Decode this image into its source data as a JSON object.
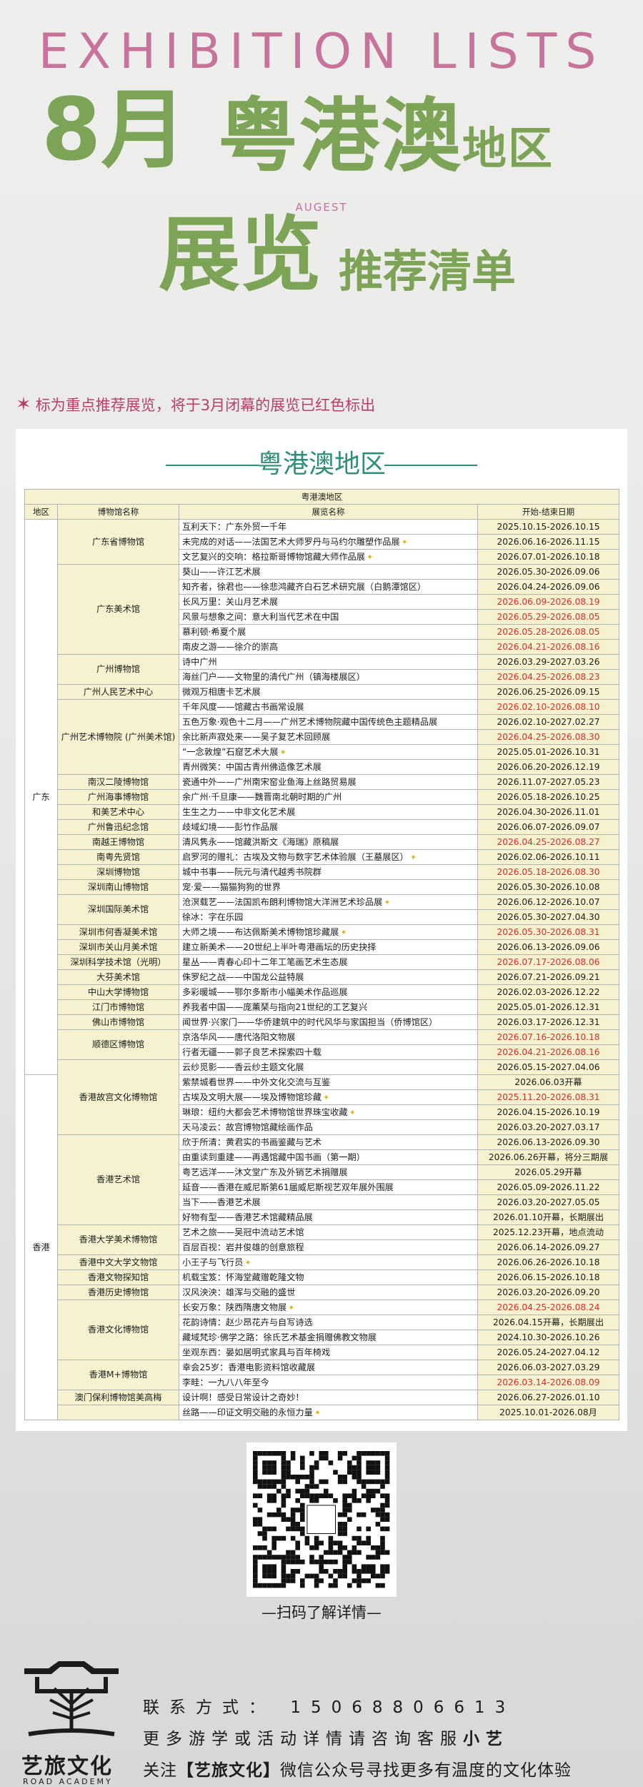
{
  "header": {
    "title_en": "EXHIBITION LISTS",
    "month": "8月",
    "region": "粤港澳",
    "region_suffix": "地区",
    "month_en": "AUGEST",
    "exhibit": "展览",
    "recommend": "推荐清单"
  },
  "note": "标为重点推荐展览，将于3月闭幕的展览已红色标出",
  "card_title": "粤港澳地区",
  "table": {
    "top_header": "粤港澳地区",
    "col_region": "地区",
    "col_venue": "博物馆名称",
    "col_exhibit": "展览名称",
    "col_date": "开始-结束日期",
    "regions": [
      "广东",
      "香港",
      ""
    ],
    "venues": [
      "广东省博物馆",
      "广东美术馆",
      "广州博物馆",
      "广州人民艺术中心",
      "广州艺术博物院 (广州美术馆)",
      "南汉二陵博物馆",
      "广州海事博物馆",
      "和美艺术中心",
      "广州鲁迅纪念馆",
      "南越王博物馆",
      "南粤先贤馆",
      "深圳博物馆",
      "深圳南山博物馆",
      "深圳国际美术馆",
      "深圳市何香凝美术馆",
      "深圳市关山月美术馆",
      "深圳科学技术馆（光明）",
      "大芬美术馆",
      "中山大学博物馆",
      "江门市博物馆",
      "佛山市博物馆",
      "顺德区博物馆",
      "香港故宫文化博物馆",
      "香港艺术馆",
      "香港大学美术博物馆",
      "香港中文大学文物馆",
      "香港文物探知馆",
      "香港历史博物馆",
      "香港文化博物馆",
      "香港M+博物馆",
      "澳门保利博物馆美高梅"
    ],
    "rows": [
      {
        "name": "互利天下：广东外贸一千年",
        "date": "2025.10.15-2026.10.15",
        "red": false,
        "star": false
      },
      {
        "name": "未完成的对话——法国艺术大师罗丹与马约尔雕塑作品展",
        "date": "2026.06.16-2026.11.15",
        "red": false,
        "star": true
      },
      {
        "name": "文艺复兴的交响：格拉斯哥博物馆藏大师作品展",
        "date": "2026.07.01-2026.10.18",
        "red": false,
        "star": true
      },
      {
        "name": "葵山——许江艺术展",
        "date": "2026.05.30-2026.09.06",
        "red": false,
        "star": false
      },
      {
        "name": "知齐者，徐君也——徐悲鸿藏齐白石艺术研究展（白鹅潭馆区）",
        "date": "2026.04.24-2026.09.06",
        "red": false,
        "star": false
      },
      {
        "name": "长风万里：关山月艺术展",
        "date": "2026.06.09-2026.08.19",
        "red": true,
        "star": false
      },
      {
        "name": "风景与想象之间：意大利当代艺术在中国",
        "date": "2026.05.29-2026.08.05",
        "red": true,
        "star": false
      },
      {
        "name": "慕利顿·希夏个展",
        "date": "2026.05.28-2026.08.05",
        "red": true,
        "star": false
      },
      {
        "name": "南皮之游——徐介的崇高",
        "date": "2026.04.21-2026.08.16",
        "red": true,
        "star": false
      },
      {
        "name": "诗中广州",
        "date": "2026.03.29-2027.03.26",
        "red": false,
        "star": false
      },
      {
        "name": "海丝门户——文物里的清代广州（镇海楼展区）",
        "date": "2026.04.25-2026.08.23",
        "red": true,
        "star": false
      },
      {
        "name": "微观万相唐卡艺术展",
        "date": "2026.06.25-2026.09.15",
        "red": false,
        "star": false
      },
      {
        "name": "千年风度——馆藏古书画常设展",
        "date": "2026.02.10-2026.08.10",
        "red": true,
        "star": false
      },
      {
        "name": "五色万象·观色十二月——广州艺术博物院藏中国传统色主题精品展",
        "date": "2026.02.10-2027.02.27",
        "red": false,
        "star": false
      },
      {
        "name": "余比新声寂处来——吴子复艺术回顾展",
        "date": "2026.04.25-2026.08.30",
        "red": true,
        "star": false
      },
      {
        "name": "“一念敦煌”石窟艺术大展",
        "date": "2025.05.01-2026.10.31",
        "red": false,
        "star": true
      },
      {
        "name": "青州微笑：中国古青州佛造像艺术展",
        "date": "2026.06.20-2026.12.19",
        "red": false,
        "star": false
      },
      {
        "name": "瓷通中外——广州南宋窑业鱼海上丝路贸易展",
        "date": "2026.11.07-2027.05.23",
        "red": false,
        "star": false
      },
      {
        "name": "余广州·千旦康——魏晋南北朝时期的广州",
        "date": "2026.05.18-2026.10.25",
        "red": false,
        "star": false
      },
      {
        "name": "生生之力——中非文化艺术展",
        "date": "2026.04.30-2026.11.01",
        "red": false,
        "star": false
      },
      {
        "name": "歧域幻境——彭竹作品展",
        "date": "2026.06.07-2026.09.07",
        "red": false,
        "star": false
      },
      {
        "name": "清风隽永——馆藏洪斯文《海瑞》原稿展",
        "date": "2026.04.25-2026.08.27",
        "red": true,
        "star": false
      },
      {
        "name": "启罗河的赠礼：古埃及文物与数字艺术体验展（王墓展区）",
        "date": "2026.02.06-2026.10.11",
        "red": false,
        "star": true
      },
      {
        "name": "城中书事——阮元与清代越秀书院群",
        "date": "2026.05.18-2026.08.30",
        "red": true,
        "star": false
      },
      {
        "name": "宠·爱——猫猫狗狗的世界",
        "date": "2026.05.30-2026.10.08",
        "red": false,
        "star": false
      },
      {
        "name": "沧溟载艺——法国凯布朗利博物馆大洋洲艺术珍品展",
        "date": "2026.06.12-2026.10.07",
        "red": false,
        "star": true
      },
      {
        "name": "徐冰：字在乐园",
        "date": "2026.05.30-2027.04.30",
        "red": false,
        "star": false
      },
      {
        "name": "大师之境——布达佩斯美术博物馆珍藏展",
        "date": "2026.05.30-2026.08.31",
        "red": true,
        "star": true
      },
      {
        "name": "建立新美术——20世纪上半叶粤港画坛的历史抉择",
        "date": "2026.06.13-2026.09.06",
        "red": false,
        "star": false
      },
      {
        "name": "星丛——青春心印十二年工笔画艺术生态展",
        "date": "2026.07.17-2026.08.06",
        "red": true,
        "star": false
      },
      {
        "name": "侏罗纪之战——中国龙公益特展",
        "date": "2026.07.21-2026.09.21",
        "red": false,
        "star": false
      },
      {
        "name": "多彩暖城——鄂尔多斯市小幅美术作品巡展",
        "date": "2026.02.03-2026.12.22",
        "red": false,
        "star": false
      },
      {
        "name": "养我者中国——庞薰琹与指向21世纪的工艺复兴",
        "date": "2025.05.01-2026.12.31",
        "red": false,
        "star": false
      },
      {
        "name": "闻世界·兴家门——华侨建筑中的时代风华与家国担当（侨博馆区）",
        "date": "2026.03.17-2026.12.31",
        "red": false,
        "star": false
      },
      {
        "name": "京洛华风——唐代洛阳文物展",
        "date": "2026.07.16-2026.10.18",
        "red": true,
        "star": false
      },
      {
        "name": "行者无疆——郭子良艺术探索四十载",
        "date": "2026.04.21-2026.08.16",
        "red": true,
        "star": false
      },
      {
        "name": "云纱觅影——香云纱主题文化展",
        "date": "2026.05.15-2027.04.06",
        "red": false,
        "star": false
      },
      {
        "name": "紫禁城看世界——中外文化交流与互鉴",
        "date": "2026.06.03开幕",
        "red": false,
        "star": false
      },
      {
        "name": "古埃及文明大展——埃及博物馆珍藏",
        "date": "2025.11.20-2026.08.31",
        "red": true,
        "star": true
      },
      {
        "name": "琳琅：纽约大都会艺术博物馆世界珠宝收藏",
        "date": "2026.04.15-2026.10.19",
        "red": false,
        "star": true
      },
      {
        "name": "天马凌云：故宫博物馆藏绘画作品",
        "date": "2026.03.20-2027.03.17",
        "red": false,
        "star": false
      },
      {
        "name": "欣于所清：黄君实的书画鉴藏与艺术",
        "date": "2026.06.13-2026.09.30",
        "red": false,
        "star": false
      },
      {
        "name": "由重读到重建——再遇馆藏中国书画（第一期）",
        "date": "2026.06.26开幕，将分三期展",
        "red": false,
        "star": false
      },
      {
        "name": "粤艺远洋——沐文堂广东及外销艺术捐赠展",
        "date": "2026.05.29开幕",
        "red": false,
        "star": false
      },
      {
        "name": "延音——香港在威尼斯第61届威尼斯视艺双年展外围展",
        "date": "2026.05.09-2026.11.22",
        "red": false,
        "star": false
      },
      {
        "name": "当下——香港艺术展",
        "date": "2026.03.20-2027.05.05",
        "red": false,
        "star": false
      },
      {
        "name": "好物有型——香港艺术馆藏精品展",
        "date": "2026.01.10开幕，长期展出",
        "red": false,
        "star": false
      },
      {
        "name": "艺术之旅——吴冠中流动艺术馆",
        "date": "2025.12.23开幕，地点流动",
        "red": false,
        "star": false
      },
      {
        "name": "百层百视：岩井俊雄的创意旅程",
        "date": "2026.06.14-2026.09.27",
        "red": false,
        "star": false
      },
      {
        "name": "小王子与飞行员",
        "date": "2026.06.26-2026.10.18",
        "red": false,
        "star": true
      },
      {
        "name": "机载宝笈：怀海堂藏赠乾隆文物",
        "date": "2026.06.15-2026.10.18",
        "red": false,
        "star": false
      },
      {
        "name": "汉风泱泱：雄浑与交融的盛世",
        "date": "2026.03.20-2026.09.20",
        "red": false,
        "star": false
      },
      {
        "name": "长安万象：陕西隋唐文物展",
        "date": "2026.04.25-2026.08.24",
        "red": true,
        "star": true
      },
      {
        "name": "花韵诗情：赵少昂花卉与自写诗选",
        "date": "2026.04.15开幕，长期展出",
        "red": false,
        "star": false
      },
      {
        "name": "藏域梵珍·佛学之路：徐氏艺术基金捐赠佛教文物展",
        "date": "2024.10.30-2026.10.26",
        "red": false,
        "star": false
      },
      {
        "name": "坐观东西：晏如居明式家具与百年椅戏",
        "date": "2026.05.24-2027.04.12",
        "red": false,
        "star": false
      },
      {
        "name": "幸会25岁：香港电影资料馆收藏展",
        "date": "2026.06.03-2027.03.29",
        "red": false,
        "star": false
      },
      {
        "name": "李畦：一九八八年至今",
        "date": "2026.03.14-2026.08.09",
        "red": true,
        "star": false
      },
      {
        "name": "设计啊！感受日常设计之奇妙！",
        "date": "2026.06.27-2026.01.10",
        "red": false,
        "star": false
      },
      {
        "name": "丝路——印证文明交融的永恒力量",
        "date": "2025.10.01-2026.08月",
        "red": false,
        "star": true
      }
    ]
  },
  "qr_caption": "—扫码了解详情—",
  "logo": {
    "brand": "艺旅文化",
    "sub": "ROAD ACADEMY"
  },
  "contact": {
    "phone_label": "联系方式：",
    "phone": "15068806613",
    "line2": "更多游学或活动详情请咨询客服",
    "line2_bold": "小艺",
    "line3_pre": "关注",
    "line3_bold": "【艺旅文化】",
    "line3_post": "微信公众号寻找更多有温度的文化体验"
  }
}
